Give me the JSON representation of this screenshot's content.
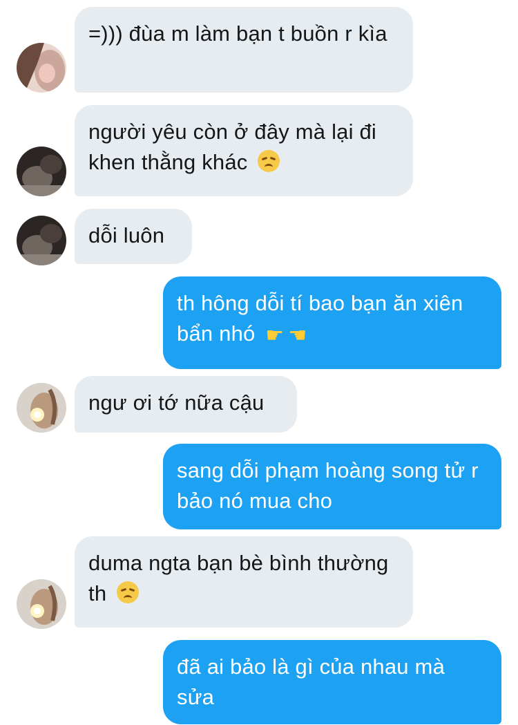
{
  "messages": [
    {
      "side": "in",
      "text": "=))) đùa m làm bạn t buồn r kìa",
      "avatar": "avatar-girl-photo"
    },
    {
      "side": "in",
      "text": "người yêu còn ở đây mà lại đi khen thằng khác",
      "emoji": "disappointed-face"
    },
    {
      "side": "in",
      "text": "dỗi luôn",
      "avatar": "avatar-dark-photo"
    },
    {
      "side": "out",
      "text": "th hông dỗi tí bao bạn ăn xiên bẩn nhó",
      "emoji": "pointing-hands"
    },
    {
      "side": "in",
      "text": "ngư ơi tớ nữa cậu",
      "avatar": "avatar-sparkler-photo"
    },
    {
      "side": "out",
      "text": "sang dỗi phạm hoàng song tử r bảo nó mua cho"
    },
    {
      "side": "in",
      "text": "duma ngta bạn bè bình thường th",
      "emoji": "disappointed-face",
      "avatar": "avatar-sparkler-photo"
    },
    {
      "side": "out",
      "text": "đã ai bảo là gì của nhau mà sửa"
    }
  ],
  "colors": {
    "incoming_bubble": "#e6ecf0",
    "outgoing_bubble": "#1da1f2",
    "incoming_text": "#14171a",
    "outgoing_text": "#ffffff"
  }
}
